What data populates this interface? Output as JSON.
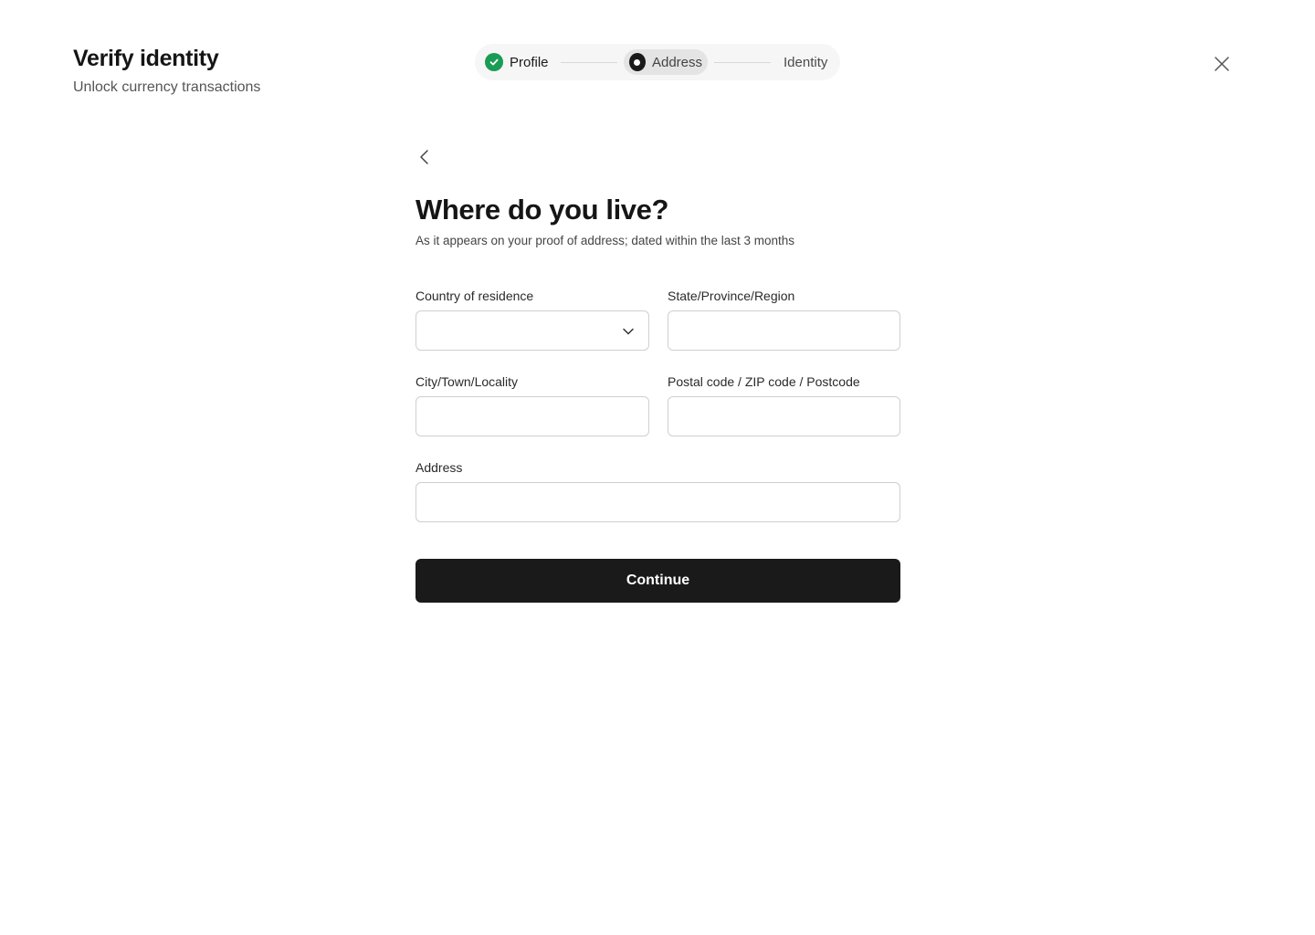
{
  "header": {
    "title": "Verify identity",
    "subtitle": "Unlock currency transactions",
    "close_icon": "close-icon"
  },
  "stepper": {
    "steps": [
      {
        "label": "Profile",
        "state": "completed",
        "icon": "check-circle-icon"
      },
      {
        "label": "Address",
        "state": "current",
        "icon": "dot-circle-icon"
      },
      {
        "label": "Identity",
        "state": "upcoming"
      }
    ],
    "completed_color": "#1a9c55"
  },
  "form": {
    "back_icon": "chevron-left-icon",
    "heading": "Where do you live?",
    "subheading": "As it appears on your proof of address; dated within the last 3 months",
    "fields": {
      "country": {
        "label": "Country of residence",
        "value": "",
        "icon": "chevron-down-icon"
      },
      "state": {
        "label": "State/Province/Region",
        "value": ""
      },
      "city": {
        "label": "City/Town/Locality",
        "value": ""
      },
      "postal": {
        "label": "Postal code / ZIP code / Postcode",
        "value": ""
      },
      "address": {
        "label": "Address",
        "value": ""
      }
    },
    "continue_label": "Continue"
  },
  "colors": {
    "primary_button": "#1a1a1a",
    "border": "#cfcfcf",
    "stepper_bg": "#f6f6f6"
  }
}
